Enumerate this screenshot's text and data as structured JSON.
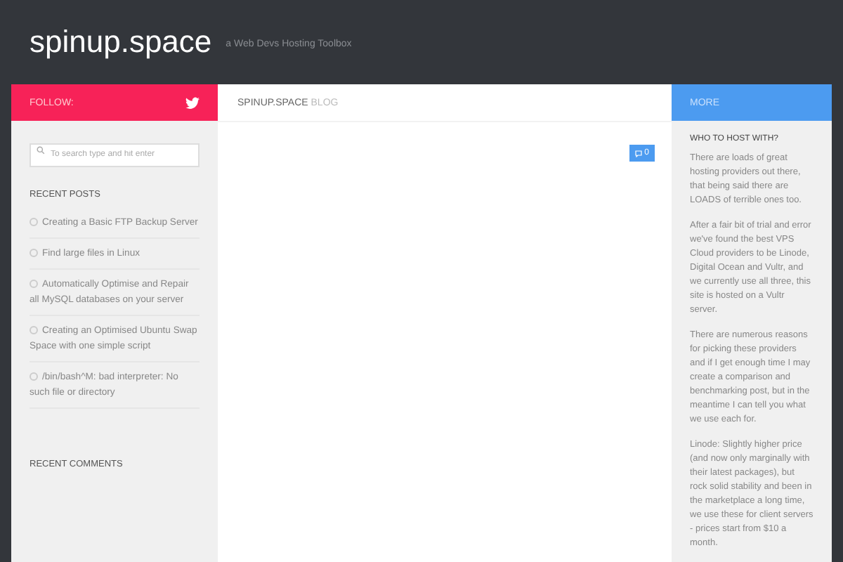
{
  "site": {
    "title": "spinup.space",
    "tagline": "a Web Devs Hosting Toolbox"
  },
  "left": {
    "bar_label": "FOLLOW:",
    "search": {
      "placeholder": "To search type and hit enter"
    },
    "recent_posts": {
      "heading": "RECENT POSTS",
      "items": [
        {
          "title": "Creating a Basic FTP Backup Server"
        },
        {
          "title": "Find large files in Linux"
        },
        {
          "title": "Automatically Optimise and Repair all MySQL databases on your server"
        },
        {
          "title": "Creating an Optimised Ubuntu Swap Space with one simple script"
        },
        {
          "title": "/bin/bash^M: bad interpreter: No such file or directory"
        }
      ]
    },
    "recent_comments": {
      "heading": "RECENT COMMENTS"
    }
  },
  "main": {
    "heading": "SPINUP.SPACE",
    "heading_suffix": "BLOG",
    "comment_count": "0"
  },
  "right": {
    "bar_label": "MORE",
    "heading": "WHO TO HOST WITH?",
    "paragraphs": [
      "There are loads of great hosting providers out there, that being said there are LOADS of terrible ones too.",
      "After a fair bit of trial and error we've found the best VPS Cloud providers to be Linode, Digital Ocean and Vultr, and we currently use all three, this site is hosted on a Vultr server.",
      "There are numerous reasons for picking these providers and if I get enough time I may create a comparison and benchmarking post, but in the meantime I can tell you what we use each for.",
      "Linode: Slightly higher price (and now only marginally with their latest packages), but rock solid stability and been in the marketplace a long time, we use these for client servers - prices start from $10 a month."
    ]
  }
}
